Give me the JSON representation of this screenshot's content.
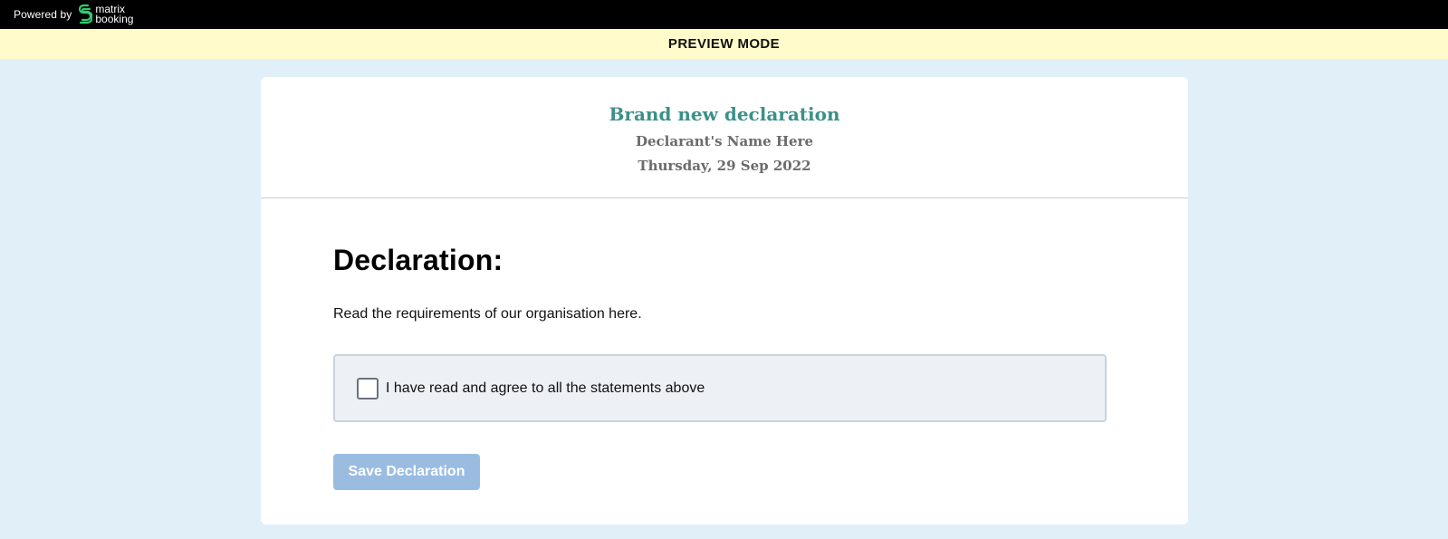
{
  "topbar": {
    "powered_by": "Powered by",
    "logo_line1": "matrix",
    "logo_line2": "booking",
    "logo_icon": "matrix-booking-logo-icon",
    "logo_color": "#2ecc71"
  },
  "preview": {
    "label": "PREVIEW MODE"
  },
  "declaration": {
    "title": "Brand new declaration",
    "declarant_name": "Declarant's Name Here",
    "date": "Thursday, 29 Sep 2022",
    "heading": "Declaration:",
    "intro": "Read the requirements of our organisation here.",
    "agree_label": "I have read and agree to all the statements above",
    "agree_checked": false,
    "save_label": "Save Declaration"
  },
  "colors": {
    "page_bg": "#e1f0f8",
    "preview_bg": "#fffbcb",
    "title_accent": "#3c9089",
    "button_disabled": "#9bbce1"
  }
}
